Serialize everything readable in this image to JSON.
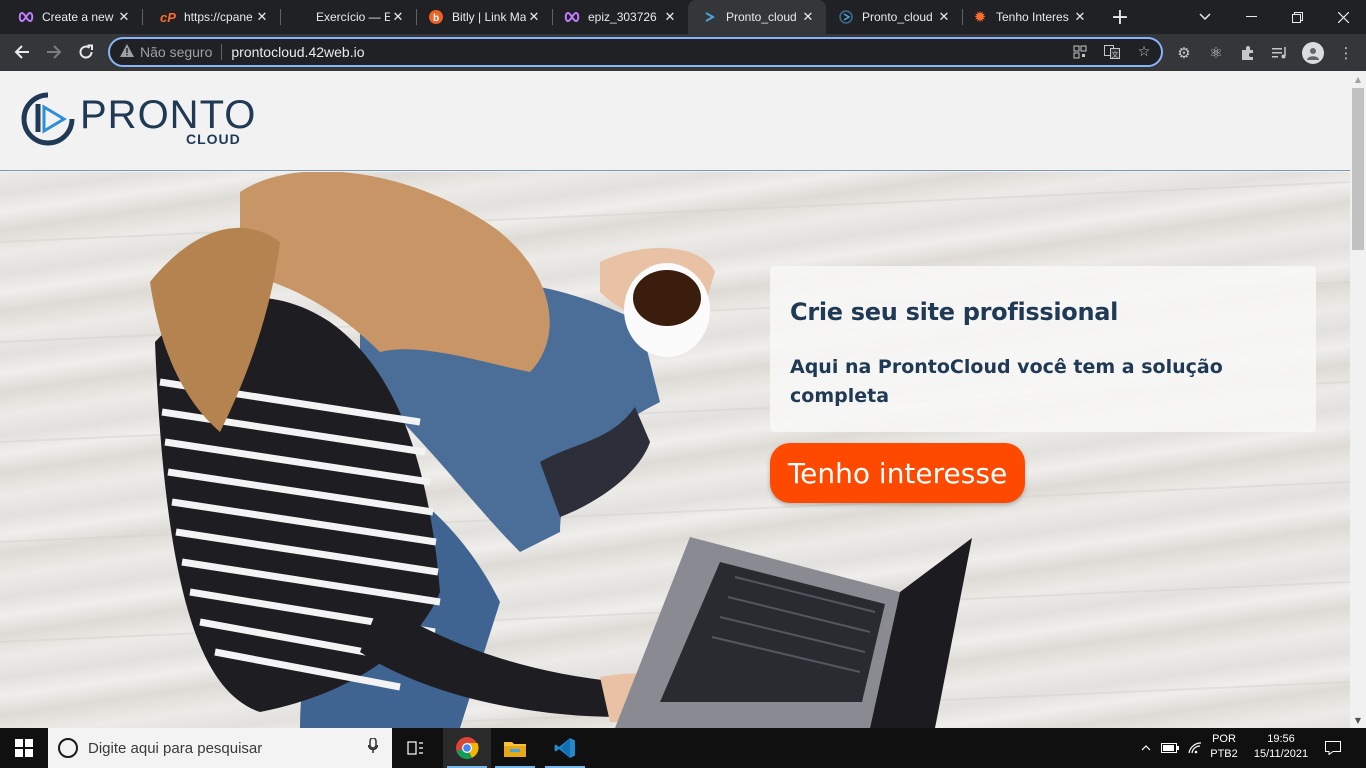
{
  "browser": {
    "tabs": [
      {
        "title": "Create a new",
        "favicon": "infinity-icon",
        "active": false
      },
      {
        "title": "https://cpane",
        "favicon": "cpanel-icon",
        "active": false
      },
      {
        "title": "Exercício — E",
        "favicon": "none",
        "active": false
      },
      {
        "title": "Bitly | Link Ma",
        "favicon": "bitly-icon",
        "active": false
      },
      {
        "title": "epiz_303726",
        "favicon": "infinity-icon",
        "active": false
      },
      {
        "title": "Pronto_cloud",
        "favicon": "pronto-icon",
        "active": true
      },
      {
        "title": "Pronto_cloud",
        "favicon": "pronto-icon",
        "active": false
      },
      {
        "title": "Tenho Interes",
        "favicon": "gear-orange-icon",
        "active": false
      }
    ],
    "omnibox": {
      "security_label": "Não seguro",
      "url": "prontocloud.42web.io"
    }
  },
  "site": {
    "logo": {
      "word": "PRONTO",
      "sub": "CLOUD"
    },
    "hero": {
      "title": "Crie seu site profissional",
      "subtitle": "Aqui na ProntoCloud você tem a solução completa",
      "cta_label": "Tenho interesse"
    }
  },
  "taskbar": {
    "search_placeholder": "Digite aqui para pesquisar",
    "language_line1": "POR",
    "language_line2": "PTB2",
    "time": "19:56",
    "date": "15/11/2021"
  },
  "colors": {
    "brand_navy": "#203a55",
    "cta_orange": "#fe4a00",
    "omnibox_focus": "#8ab4f8"
  }
}
